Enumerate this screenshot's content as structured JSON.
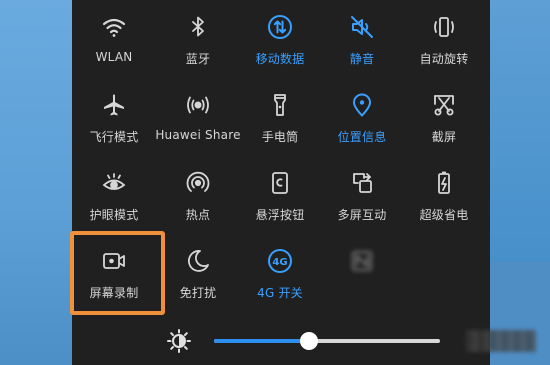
{
  "tiles": [
    {
      "label": "WLAN",
      "icon": "wifi-icon",
      "active": false
    },
    {
      "label": "蓝牙",
      "icon": "bluetooth-icon",
      "active": false
    },
    {
      "label": "移动数据",
      "icon": "mobile-data-icon",
      "active": true
    },
    {
      "label": "静音",
      "icon": "mute-icon",
      "active": true
    },
    {
      "label": "自动旋转",
      "icon": "auto-rotate-icon",
      "active": false
    },
    {
      "label": "飞行模式",
      "icon": "airplane-icon",
      "active": false
    },
    {
      "label": "Huawei Share",
      "icon": "huawei-share-icon",
      "active": false
    },
    {
      "label": "手电筒",
      "icon": "flashlight-icon",
      "active": false
    },
    {
      "label": "位置信息",
      "icon": "location-icon",
      "active": true
    },
    {
      "label": "截屏",
      "icon": "screenshot-icon",
      "active": false
    },
    {
      "label": "护眼模式",
      "icon": "eye-comfort-icon",
      "active": false
    },
    {
      "label": "热点",
      "icon": "hotspot-icon",
      "active": false
    },
    {
      "label": "悬浮按钮",
      "icon": "floating-button-icon",
      "active": false
    },
    {
      "label": "多屏互动",
      "icon": "multi-screen-icon",
      "active": false
    },
    {
      "label": "超级省电",
      "icon": "ultra-power-saving-icon",
      "active": false
    },
    {
      "label": "屏幕录制",
      "icon": "screen-record-icon",
      "active": false
    },
    {
      "label": "免打扰",
      "icon": "do-not-disturb-icon",
      "active": false
    },
    {
      "label": "4G 开关",
      "icon": "4g-icon",
      "active": true
    },
    {
      "label": "",
      "icon": "nfc-icon",
      "active": false
    }
  ],
  "brightness": {
    "level": 0.42,
    "icon": "brightness-icon"
  },
  "colors": {
    "active": "#3aa0ff",
    "inactive": "#d6d6d6",
    "panel": "#202020",
    "highlight": "#f0903a",
    "slider": "#2f8ff0"
  }
}
